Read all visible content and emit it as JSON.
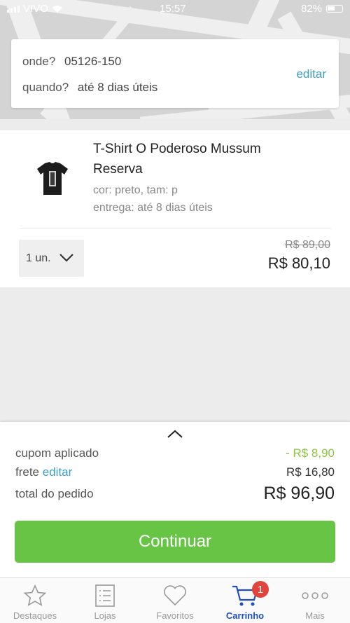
{
  "status_bar": {
    "carrier": "VIVO",
    "time": "15:57",
    "battery": "82%"
  },
  "delivery": {
    "where_label": "onde?",
    "where_value": "05126-150",
    "when_label": "quando?",
    "when_value": "até 8 dias úteis",
    "edit_label": "editar"
  },
  "product": {
    "title": "T-Shirt O Poderoso Mussum Reserva",
    "attributes": "cor: preto, tam: p",
    "delivery": "entrega: até 8 dias úteis",
    "quantity": "1 un.",
    "old_price": "R$ 89,00",
    "price": "R$ 80,10"
  },
  "summary": {
    "coupon_label": "cupom aplicado",
    "coupon_value": "- R$ 8,90",
    "shipping_label": "frete",
    "shipping_edit": "editar",
    "shipping_value": "R$ 16,80",
    "total_label": "total do pedido",
    "total_value": "R$ 96,90",
    "continue_label": "Continuar"
  },
  "tabs": [
    {
      "label": "Destaques",
      "icon": "star-icon"
    },
    {
      "label": "Lojas",
      "icon": "list-icon"
    },
    {
      "label": "Favoritos",
      "icon": "heart-icon"
    },
    {
      "label": "Carrinho",
      "icon": "cart-icon",
      "badge": "1",
      "active": true
    },
    {
      "label": "Mais",
      "icon": "more-icon"
    }
  ],
  "colors": {
    "accent": "#3aa0c8",
    "primary_button": "#67c444",
    "active_tab": "#1f4fb8",
    "badge": "#e2433c",
    "discount": "#8cc63f"
  }
}
